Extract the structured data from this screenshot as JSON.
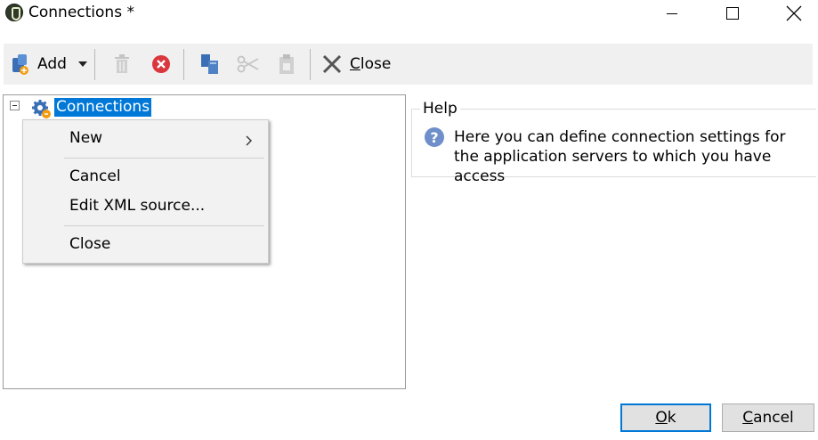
{
  "window": {
    "title": "Connections *"
  },
  "toolbar": {
    "add_label": "Add",
    "close_label": "Close"
  },
  "tree": {
    "root_label": "Connections"
  },
  "context_menu": {
    "items": [
      "New",
      "Cancel",
      "Edit XML source...",
      "Close"
    ],
    "submenu_arrow": ">"
  },
  "help": {
    "title": "Help",
    "icon_glyph": "?",
    "text": "Here you can define connection settings for the application servers to which you have access"
  },
  "buttons": {
    "ok_label": "Ok",
    "cancel_label": "Cancel"
  },
  "colors": {
    "selection": "#0078d7",
    "delete_red": "#d9363e",
    "add_blue": "#3a6fb5",
    "add_orange": "#f39c12"
  },
  "icons": {
    "app": "app-logo-icon",
    "add": "add-connection-icon",
    "delete": "trash-icon",
    "cancel": "red-x-circle-icon",
    "copy": "copy-icon",
    "cut": "scissors-icon",
    "paste": "clipboard-icon",
    "close": "x-icon",
    "tree_node": "connection-gear-icon",
    "help": "question-circle-icon"
  }
}
